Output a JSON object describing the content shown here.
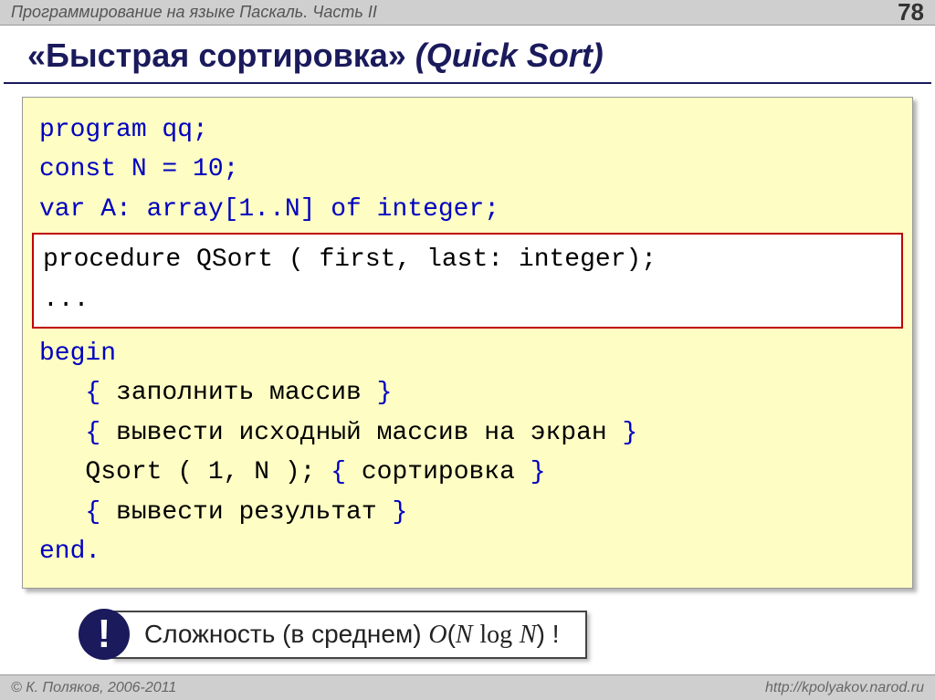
{
  "header": {
    "title": "Программирование на языке Паскаль. Часть II",
    "page": "78"
  },
  "title": {
    "main": "«Быстрая сортировка» ",
    "italic": "(Quick Sort)"
  },
  "code": {
    "l1": "program qq;",
    "l2": "const N = 10;",
    "l3": "var A: array[1..N] of integer;",
    "h1": "procedure QSort ( first, last: integer);",
    "h2": "...",
    "l4": "begin",
    "l5a": "   { ",
    "l5b": "заполнить массив",
    "l5c": " }",
    "l6a": "   { ",
    "l6b": "вывести исходный массив на экран",
    "l6c": " }",
    "l7a": "   Qsort ( 1, N );",
    "l7b": " { ",
    "l7c": "сортировка",
    "l7d": " }",
    "l8a": "   { ",
    "l8b": "вывести результат",
    "l8c": " }",
    "l9": "end."
  },
  "note": {
    "bang": "!",
    "pre": " Сложность (в среднем) ",
    "O": "O",
    "open": "(",
    "N1": "N",
    "sp": " ",
    "log": "log",
    "N2": "N",
    "close": ")",
    "excl": " !"
  },
  "footer": {
    "left": "© К. Поляков, 2006-2011",
    "right": "http://kpolyakov.narod.ru"
  }
}
